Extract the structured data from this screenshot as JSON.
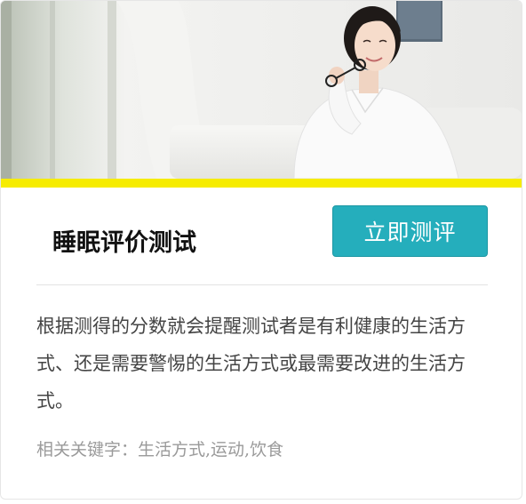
{
  "card": {
    "hero_image": "woman-in-white-shirt-photo",
    "accent_color": "#f6ec00",
    "title": "睡眠评价测试",
    "cta_label": "立即测评",
    "cta_color": "#25aebc",
    "description": "根据测得的分数就会提醒测试者是有利健康的生活方式、还是需要警惕的生活方式或最需要改进的生活方式。",
    "keywords_label": "相关关键字：",
    "keywords_value": "生活方式,运动,饮食"
  }
}
